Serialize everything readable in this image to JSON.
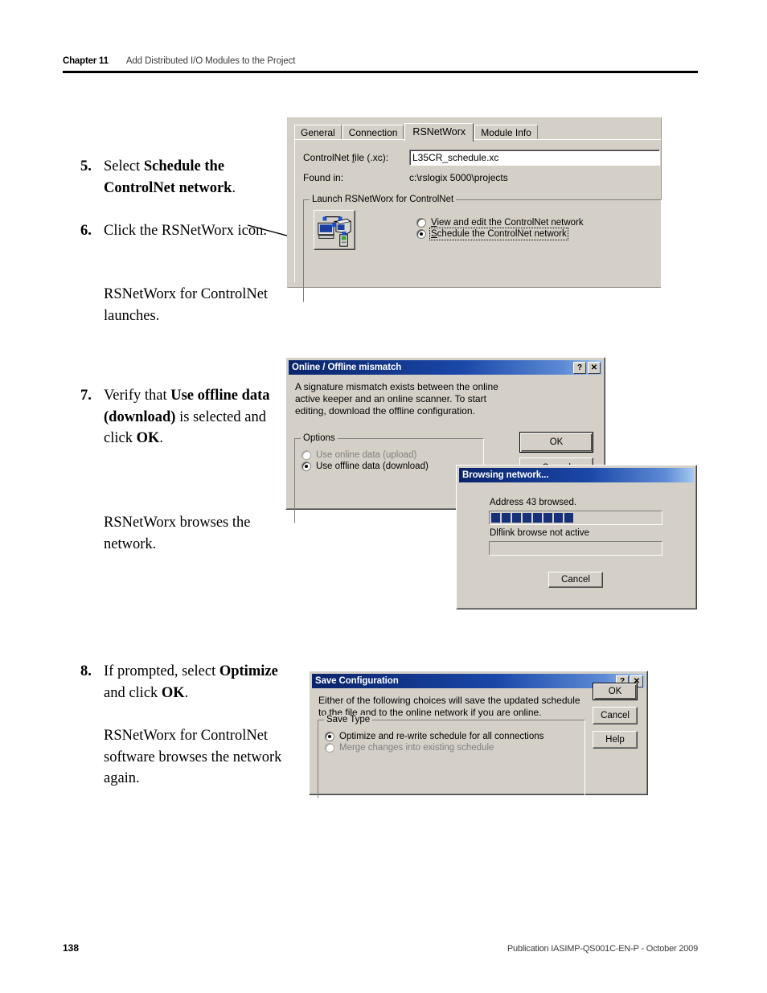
{
  "header": {
    "chapter": "Chapter 11",
    "chapter_title": "Add Distributed I/O Modules to the Project"
  },
  "steps": [
    {
      "number": "5.",
      "text_parts": [
        "Select ",
        "Schedule the ControlNet network",
        "."
      ]
    },
    {
      "number": "6.",
      "text_parts": [
        "Click the RSNetWorx icon.",
        "",
        ""
      ]
    },
    {
      "number": "7.",
      "text_parts": [
        "Verify that ",
        "Use offline data (download)",
        " is selected and click ",
        "OK",
        "."
      ]
    },
    {
      "number": "8.",
      "text_parts": [
        "If prompted, select ",
        "Optimize",
        " and click ",
        "OK",
        "."
      ]
    }
  ],
  "step5": {
    "number": "5.",
    "lead": "Select ",
    "bold": "Schedule the ControlNet network",
    "tail": "."
  },
  "step6": {
    "number": "6.",
    "text": "Click the RSNetWorx icon.",
    "note": "RSNetWorx for ControlNet launches."
  },
  "step7": {
    "number": "7.",
    "lead": "Verify that ",
    "bold1": "Use offline data (download)",
    "mid": " is selected and click ",
    "bold2": "OK",
    "tail": ".",
    "note": "RSNetWorx browses the network."
  },
  "step8": {
    "number": "8.",
    "lead": "If prompted, select ",
    "bold1": "Optimize",
    "mid": " and click ",
    "bold2": "OK",
    "tail": ".",
    "note": "RSNetWorx for ControlNet software browses the network again."
  },
  "module_dialog": {
    "tabs": [
      {
        "label": "General",
        "active": false
      },
      {
        "label": "Connection",
        "active": false
      },
      {
        "label": "RSNetWorx",
        "active": true
      },
      {
        "label": "Module Info",
        "active": false
      }
    ],
    "file_label": "ControlNet file (.xc):",
    "file_value": "L35CR_schedule.xc",
    "found_in_label": "Found in:",
    "found_in_value": "c:\\rslogix 5000\\projects",
    "groupbox_label": "Launch RSNetWorx for ControlNet",
    "icon_name": "rsnetworx-network-icon",
    "options": [
      {
        "label": "View and edit the ControlNet network",
        "selected": false
      },
      {
        "label": "Schedule the ControlNet network",
        "selected": true
      }
    ]
  },
  "mismatch_dialog": {
    "title": "Online / Offline mismatch",
    "help_button": "?",
    "close_button": "✕",
    "message": "A signature mismatch exists between the online active keeper and an online scanner. To start editing, download the offline configuration.",
    "groupbox_label": "Options",
    "options": [
      {
        "label": "Use online data (upload)",
        "selected": false,
        "disabled": true
      },
      {
        "label": "Use offline data (download)",
        "selected": true,
        "disabled": false
      }
    ],
    "ok_label": "OK",
    "cancel_label": "Cancel"
  },
  "browse_dialog": {
    "title": "Browsing network...",
    "status_primary": "Address 43 browsed.",
    "progress_blocks": 8,
    "progress_color": "#17307a",
    "status_secondary": "Dlflink browse not active",
    "cancel_label": "Cancel"
  },
  "save_dialog": {
    "title": "Save Configuration",
    "help_button": "?",
    "close_button": "✕",
    "message": "Either of the following choices will save the updated schedule to the file and to the online network if you are online.",
    "groupbox_label": "Save Type",
    "options": [
      {
        "label": "Optimize and re-write schedule for all connections",
        "selected": true,
        "disabled": false
      },
      {
        "label": "Merge changes into existing schedule",
        "selected": false,
        "disabled": true
      }
    ],
    "buttons": [
      {
        "label": "OK"
      },
      {
        "label": "Cancel"
      },
      {
        "label": "Help"
      }
    ]
  },
  "footer": {
    "page_number": "138",
    "publication": "Publication IASIMP-QS001C-EN-P - October 2009"
  }
}
